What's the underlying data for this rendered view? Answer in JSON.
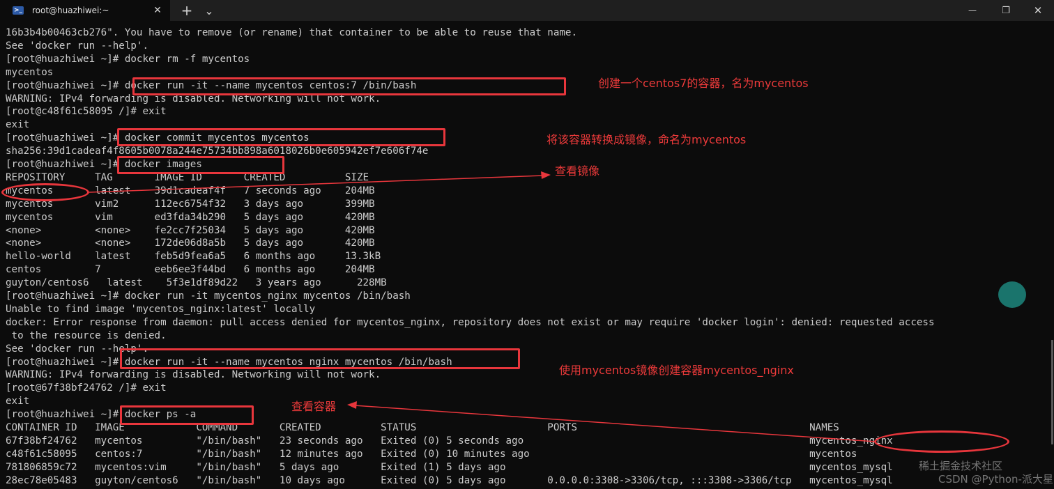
{
  "window": {
    "tab_title": "root@huazhiwei:~",
    "tab_close": "✕",
    "new_tab": "+",
    "dropdown": "⌄",
    "min": "—",
    "max": "❐",
    "close": "✕"
  },
  "terminal": {
    "lines": [
      "16b3b4b00463cb276\". You have to remove (or rename) that container to be able to reuse that name.",
      "See 'docker run --help'.",
      "[root@huazhiwei ~]# docker rm -f mycentos",
      "mycentos",
      "[root@huazhiwei ~]# docker run -it --name mycentos centos:7 /bin/bash",
      "WARNING: IPv4 forwarding is disabled. Networking will not work.",
      "[root@c48f61c58095 /]# exit",
      "exit",
      "[root@huazhiwei ~]# docker commit mycentos mycentos",
      "sha256:39d1cadeaf4f8605b0078a244e75734bb898a6018026b0e605942ef7e606f74e",
      "[root@huazhiwei ~]# docker images",
      "REPOSITORY     TAG       IMAGE ID       CREATED          SIZE",
      "mycentos       latest    39d1cadeaf4f   7 seconds ago    204MB",
      "mycentos       vim2      112ec6754f32   3 days ago       399MB",
      "mycentos       vim       ed3fda34b290   5 days ago       420MB",
      "<none>         <none>    fe2cc7f25034   5 days ago       420MB",
      "<none>         <none>    172de06d8a5b   5 days ago       420MB",
      "hello-world    latest    feb5d9fea6a5   6 months ago     13.3kB",
      "centos         7         eeb6ee3f44bd   6 months ago     204MB",
      "guyton/centos6   latest    5f3e1df89d22   3 years ago      228MB",
      "[root@huazhiwei ~]# docker run -it mycentos_nginx mycentos /bin/bash",
      "Unable to find image 'mycentos_nginx:latest' locally",
      "docker: Error response from daemon: pull access denied for mycentos_nginx, repository does not exist or may require 'docker login': denied: requested access",
      " to the resource is denied.",
      "See 'docker run --help'.",
      "[root@huazhiwei ~]# docker run -it --name mycentos_nginx mycentos /bin/bash",
      "WARNING: IPv4 forwarding is disabled. Networking will not work.",
      "[root@67f38bf24762 /]# exit",
      "exit",
      "[root@huazhiwei ~]# docker ps -a",
      "CONTAINER ID   IMAGE            COMMAND       CREATED          STATUS                      PORTS                                       NAMES",
      "67f38bf24762   mycentos         \"/bin/bash\"   23 seconds ago   Exited (0) 5 seconds ago                                                mycentos_nginx",
      "c48f61c58095   centos:7         \"/bin/bash\"   12 minutes ago   Exited (0) 10 minutes ago                                               mycentos",
      "781806859c72   mycentos:vim     \"/bin/bash\"   5 days ago       Exited (1) 5 days ago                                                   mycentos_mysql",
      "28ec78e05483   guyton/centos6   \"/bin/bash\"   10 days ago      Exited (0) 5 days ago       0.0.0.0:3308->3306/tcp, :::3308->3306/tcp   mycentos_mysql"
    ]
  },
  "annotations": {
    "note1": "创建一个centos7的容器，名为mycentos",
    "note2": "将该容器转换成镜像，命名为mycentos",
    "note3": "查看镜像",
    "note4": "使用mycentos镜像创建容器mycentos_nginx",
    "note5": "查看容器",
    "color": "#e8363c"
  },
  "watermark": {
    "line1": "稀土掘金技术社区",
    "line2": "CSDN @Python-派大星"
  }
}
